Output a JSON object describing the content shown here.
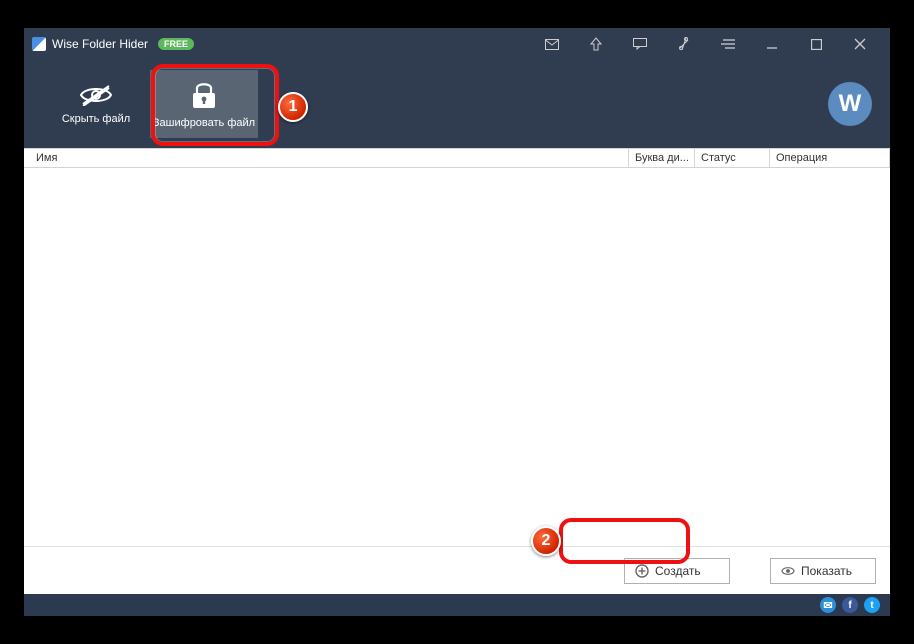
{
  "title": "Wise Folder Hider",
  "badge": "FREE",
  "toolbar": {
    "hide_label": "Скрыть файл",
    "encrypt_label": "Зашифровать файл"
  },
  "columns": {
    "name": "Имя",
    "drive": "Буква ди...",
    "status": "Статус",
    "operation": "Операция"
  },
  "actions": {
    "create": "Создать",
    "show": "Показать"
  },
  "steps": {
    "one": "1",
    "two": "2"
  },
  "logo_letter": "W",
  "social": {
    "mail": "✉",
    "fb": "f",
    "tw": "t"
  }
}
